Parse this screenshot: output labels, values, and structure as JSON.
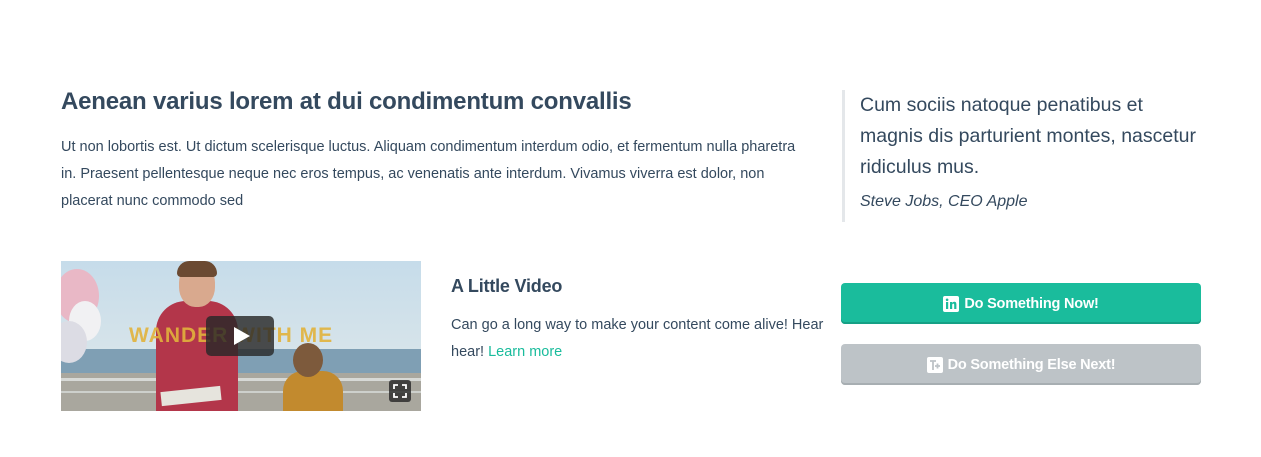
{
  "intro": {
    "title": "Aenean varius lorem at dui condimentum convallis",
    "text": "Ut non lobortis est. Ut dictum scelerisque luctus. Aliquam condimentum interdum odio, et fermentum nulla pharetra in. Praesent pellentesque neque nec eros tempus, ac venenatis ante interdum. Vivamus viverra est dolor, non placerat nunc commodo sed"
  },
  "quote": {
    "text": "Cum sociis natoque penatibus et magnis dis parturient montes, nascetur ridiculus mus.",
    "author": "Steve Jobs, CEO Apple"
  },
  "video": {
    "overlay_text": "WANDER WITH ME",
    "play_icon": "play-icon",
    "fullscreen_icon": "fullscreen-icon"
  },
  "video_section": {
    "title": "A Little Video",
    "text": "Can go a long way to make your content come alive! Hear hear!",
    "link_label": "Learn more"
  },
  "buttons": {
    "primary": {
      "label": "Do Something Now!",
      "icon": "linkedin-icon",
      "color": "#1abc9c"
    },
    "secondary": {
      "label": "Do Something Else Next!",
      "icon": "google-plus-icon",
      "color": "#bdc3c7"
    }
  },
  "colors": {
    "text": "#34495e",
    "accent": "#1abc9c"
  }
}
